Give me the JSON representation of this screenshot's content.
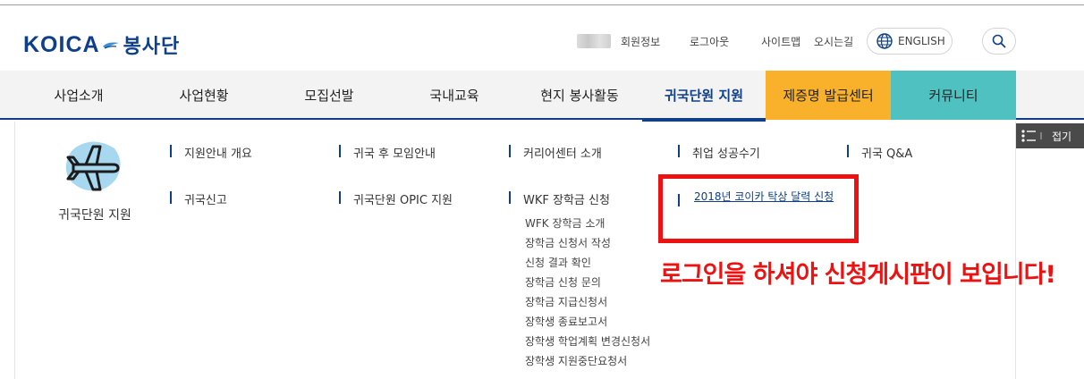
{
  "header": {
    "logo_en": "KOICA",
    "logo_ko": "봉사단",
    "util": {
      "member": "회원정보",
      "logout": "로그아웃",
      "sitemap": "사이트맵",
      "directions": "오시는길",
      "language": "ENGLISH"
    }
  },
  "nav": {
    "items": [
      {
        "label": "사업소개"
      },
      {
        "label": "사업현황"
      },
      {
        "label": "모집선발"
      },
      {
        "label": "국내교육"
      },
      {
        "label": "현지 봉사활동"
      },
      {
        "label": "귀국단원 지원"
      },
      {
        "label": "제증명 발급센터"
      },
      {
        "label": "커뮤니티"
      }
    ],
    "active": "귀국단원 지원"
  },
  "mega": {
    "category_title": "귀국단원 지원",
    "category_icon": "airplane-icon",
    "links": {
      "support_overview": "지원안내 개요",
      "reunion": "귀국 후 모임안내",
      "career_center": "커리어센터 소개",
      "success_stories": "취업 성공수기",
      "qna": "귀국 Q&A",
      "return_report": "귀국신고",
      "opic": "귀국단원 OPIC 지원",
      "wkf": "WKF 장학금 신청",
      "calendar_apply": "2018년 코이카 탁상 달력 신청"
    },
    "wkf_sub": [
      "WFK 장학금 소개",
      "장학금 신청서 작성",
      "신청 결과 확인",
      "장학금 신청 문의",
      "장학금 지급신청서",
      "장학생 종료보고서",
      "장학생 학업계획 변경신청서",
      "장학생 지원중단요청서"
    ],
    "fold_label": "접기"
  },
  "annotation": {
    "notice": "로그인을 하셔야 신청게시판이 보입니다!",
    "color": "#ee1111"
  },
  "colors": {
    "brand": "#0f3f8a",
    "cert_bg": "#f9b12b",
    "comm_bg": "#50c1c1"
  }
}
